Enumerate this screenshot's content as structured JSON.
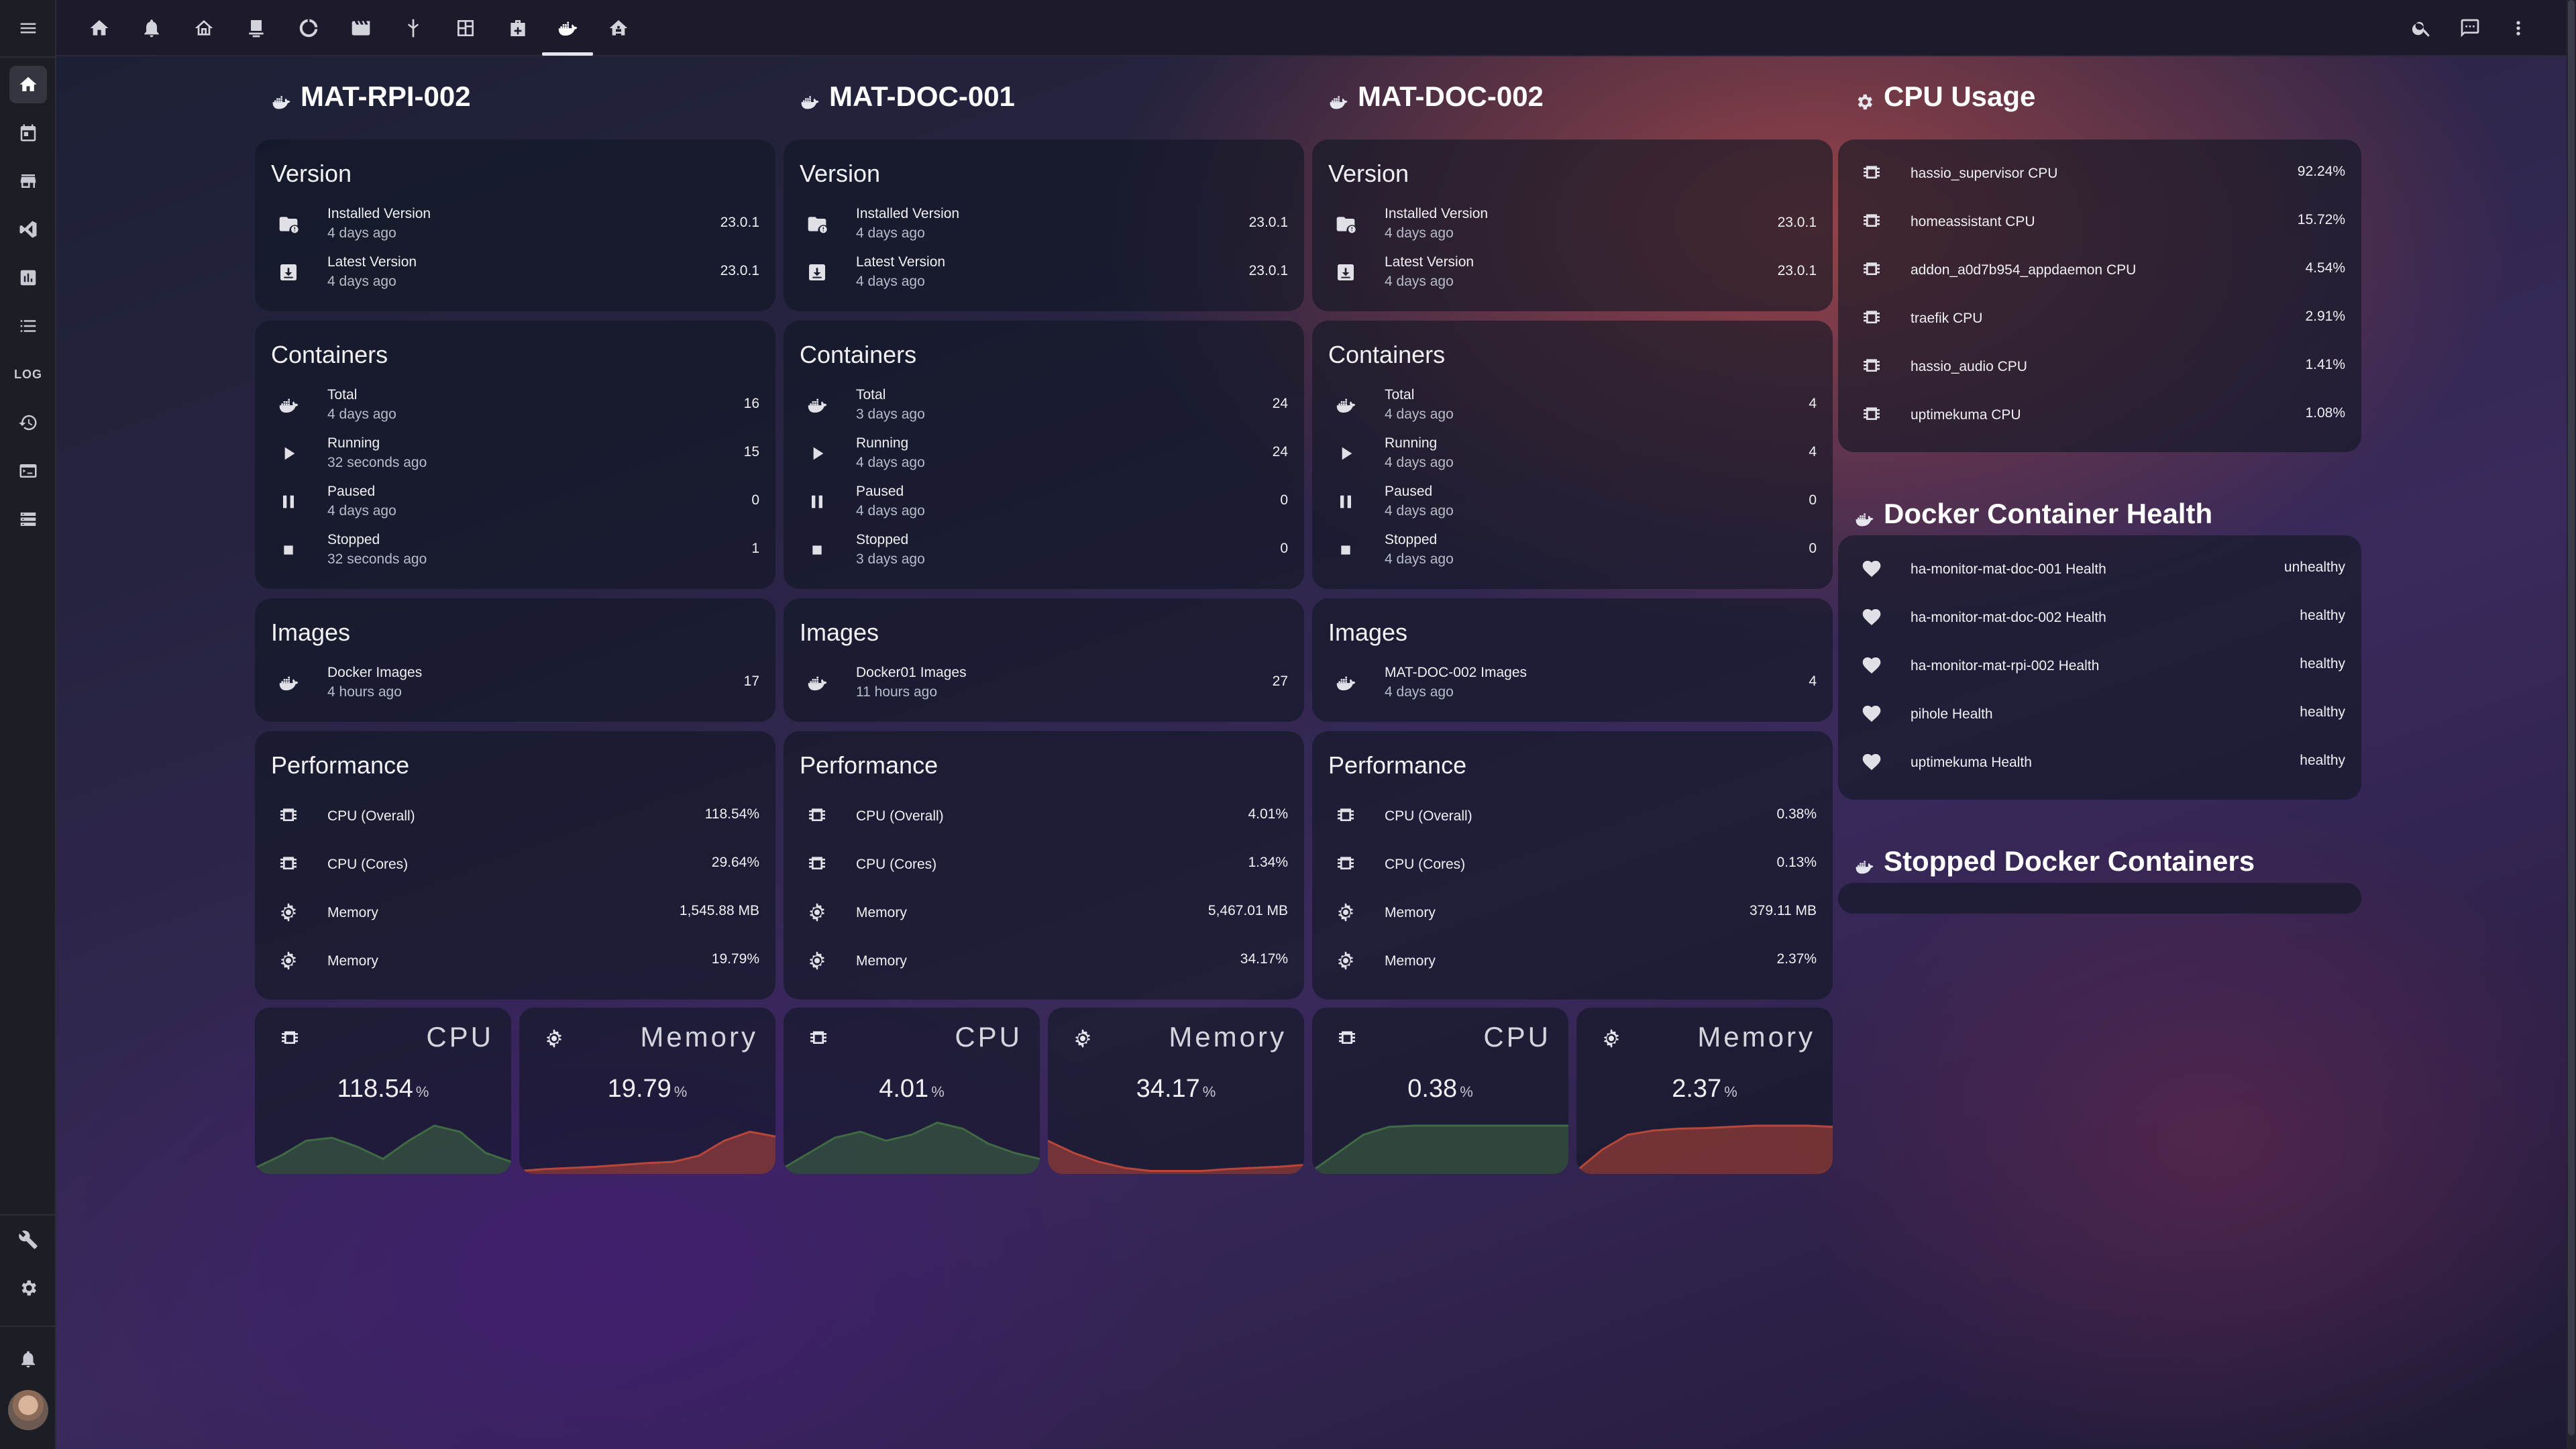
{
  "header": {
    "tabs": [
      "home-icon",
      "bell-icon",
      "house-outline-icon",
      "monitor-icon",
      "chart-donut-icon",
      "calendar-icon",
      "valve-icon",
      "floorplan-icon",
      "medkit-icon",
      "docker-icon",
      "house-network-icon"
    ],
    "active_tab": "docker-icon"
  },
  "sidebar": {
    "items": [
      "home-icon",
      "calendar-icon",
      "store-icon",
      "vscode-icon",
      "chart-box-icon",
      "list-icon",
      "log-text",
      "history-icon",
      "terminal-icon",
      "server-icon"
    ],
    "log_label": "LOG",
    "bottom": [
      "wrench-icon",
      "gear-icon",
      "bell-icon",
      "avatar"
    ]
  },
  "hosts": [
    {
      "name": "MAT-RPI-002",
      "version": {
        "title": "Version",
        "installed_label": "Installed Version",
        "installed_time": "4 days ago",
        "installed_value": "23.0.1",
        "latest_label": "Latest Version",
        "latest_time": "4 days ago",
        "latest_value": "23.0.1"
      },
      "containers": {
        "title": "Containers",
        "rows": [
          {
            "label": "Total",
            "time": "4 days ago",
            "value": "16"
          },
          {
            "label": "Running",
            "time": "32 seconds ago",
            "value": "15"
          },
          {
            "label": "Paused",
            "time": "4 days ago",
            "value": "0"
          },
          {
            "label": "Stopped",
            "time": "32 seconds ago",
            "value": "1"
          }
        ]
      },
      "images": {
        "title": "Images",
        "label": "Docker Images",
        "time": "4 hours ago",
        "value": "17"
      },
      "performance": {
        "title": "Performance",
        "rows": [
          {
            "label": "CPU (Overall)",
            "value": "118.54%"
          },
          {
            "label": "CPU (Cores)",
            "value": "29.64%"
          },
          {
            "label": "Memory",
            "value": "1,545.88 MB"
          },
          {
            "label": "Memory",
            "value": "19.79%"
          }
        ]
      },
      "graphs": [
        {
          "name": "CPU",
          "value": "118.54",
          "unit": "%",
          "color": "#3f6a44",
          "trend": [
            0.1,
            0.3,
            0.55,
            0.6,
            0.45,
            0.25,
            0.55,
            0.8,
            0.7,
            0.35,
            0.2
          ]
        },
        {
          "name": "Memory",
          "value": "19.79",
          "unit": "%",
          "color": "#b8473a",
          "trend": [
            0.05,
            0.08,
            0.1,
            0.12,
            0.15,
            0.18,
            0.2,
            0.3,
            0.55,
            0.7,
            0.62
          ]
        }
      ]
    },
    {
      "name": "MAT-DOC-001",
      "version": {
        "title": "Version",
        "installed_label": "Installed Version",
        "installed_time": "4 days ago",
        "installed_value": "23.0.1",
        "latest_label": "Latest Version",
        "latest_time": "4 days ago",
        "latest_value": "23.0.1"
      },
      "containers": {
        "title": "Containers",
        "rows": [
          {
            "label": "Total",
            "time": "3 days ago",
            "value": "24"
          },
          {
            "label": "Running",
            "time": "4 days ago",
            "value": "24"
          },
          {
            "label": "Paused",
            "time": "4 days ago",
            "value": "0"
          },
          {
            "label": "Stopped",
            "time": "3 days ago",
            "value": "0"
          }
        ]
      },
      "images": {
        "title": "Images",
        "label": "Docker01 Images",
        "time": "11 hours ago",
        "value": "27"
      },
      "performance": {
        "title": "Performance",
        "rows": [
          {
            "label": "CPU (Overall)",
            "value": "4.01%"
          },
          {
            "label": "CPU (Cores)",
            "value": "1.34%"
          },
          {
            "label": "Memory",
            "value": "5,467.01 MB"
          },
          {
            "label": "Memory",
            "value": "34.17%"
          }
        ]
      },
      "graphs": [
        {
          "name": "CPU",
          "value": "4.01",
          "unit": "%",
          "color": "#3f6a44",
          "trend": [
            0.1,
            0.35,
            0.6,
            0.7,
            0.55,
            0.65,
            0.85,
            0.75,
            0.5,
            0.35,
            0.25
          ]
        },
        {
          "name": "Memory",
          "value": "34.17",
          "unit": "%",
          "color": "#b8473a",
          "trend": [
            0.55,
            0.35,
            0.2,
            0.1,
            0.05,
            0.05,
            0.05,
            0.08,
            0.1,
            0.12,
            0.15
          ]
        }
      ]
    },
    {
      "name": "MAT-DOC-002",
      "version": {
        "title": "Version",
        "installed_label": "Installed Version",
        "installed_time": "4 days ago",
        "installed_value": "23.0.1",
        "latest_label": "Latest Version",
        "latest_time": "4 days ago",
        "latest_value": "23.0.1"
      },
      "containers": {
        "title": "Containers",
        "rows": [
          {
            "label": "Total",
            "time": "4 days ago",
            "value": "4"
          },
          {
            "label": "Running",
            "time": "4 days ago",
            "value": "4"
          },
          {
            "label": "Paused",
            "time": "4 days ago",
            "value": "0"
          },
          {
            "label": "Stopped",
            "time": "4 days ago",
            "value": "0"
          }
        ]
      },
      "images": {
        "title": "Images",
        "label": "MAT-DOC-002 Images",
        "time": "4 days ago",
        "value": "4"
      },
      "performance": {
        "title": "Performance",
        "rows": [
          {
            "label": "CPU (Overall)",
            "value": "0.38%"
          },
          {
            "label": "CPU (Cores)",
            "value": "0.13%"
          },
          {
            "label": "Memory",
            "value": "379.11 MB"
          },
          {
            "label": "Memory",
            "value": "2.37%"
          }
        ]
      },
      "graphs": [
        {
          "name": "CPU",
          "value": "0.38",
          "unit": "%",
          "color": "#3f6a44",
          "trend": [
            0.05,
            0.35,
            0.65,
            0.78,
            0.8,
            0.8,
            0.8,
            0.8,
            0.8,
            0.8,
            0.8
          ]
        },
        {
          "name": "Memory",
          "value": "2.37",
          "unit": "%",
          "color": "#b8473a",
          "trend": [
            0.05,
            0.4,
            0.65,
            0.72,
            0.75,
            0.76,
            0.78,
            0.8,
            0.8,
            0.8,
            0.78
          ]
        }
      ]
    }
  ],
  "cpu_usage": {
    "title": "CPU Usage",
    "rows": [
      {
        "label": "hassio_supervisor CPU",
        "value": "92.24%"
      },
      {
        "label": "homeassistant CPU",
        "value": "15.72%"
      },
      {
        "label": "addon_a0d7b954_appdaemon CPU",
        "value": "4.54%"
      },
      {
        "label": "traefik CPU",
        "value": "2.91%"
      },
      {
        "label": "hassio_audio CPU",
        "value": "1.41%"
      },
      {
        "label": "uptimekuma CPU",
        "value": "1.08%"
      }
    ]
  },
  "health": {
    "title": "Docker Container Health",
    "rows": [
      {
        "label": "ha-monitor-mat-doc-001 Health",
        "value": "unhealthy"
      },
      {
        "label": "ha-monitor-mat-doc-002 Health",
        "value": "healthy"
      },
      {
        "label": "ha-monitor-mat-rpi-002 Health",
        "value": "healthy"
      },
      {
        "label": "pihole Health",
        "value": "healthy"
      },
      {
        "label": "uptimekuma Health",
        "value": "healthy"
      }
    ]
  },
  "stopped": {
    "title": "Stopped Docker Containers"
  }
}
